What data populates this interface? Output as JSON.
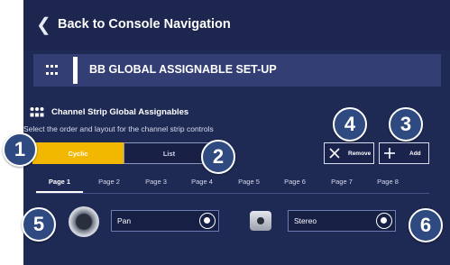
{
  "nav": {
    "back_label": "Back to Console Navigation"
  },
  "header": {
    "title": "BB GLOBAL ASSIGNABLE SET-UP"
  },
  "section": {
    "title": "Channel Strip Global Assignables",
    "description": "Select the order and layout for the channel strip controls"
  },
  "layout_toggle": {
    "options": [
      "Cyclic",
      "List"
    ],
    "selected": "Cyclic"
  },
  "actions": {
    "remove_label": "Remove",
    "add_label": "Add"
  },
  "pages": {
    "tabs": [
      "Page 1",
      "Page 2",
      "Page 3",
      "Page 4",
      "Page 5",
      "Page 6",
      "Page 7",
      "Page 8"
    ],
    "active": "Page 1"
  },
  "assignables": [
    {
      "value": "Pan"
    },
    {
      "value": "Stereo"
    }
  ],
  "callouts": [
    "1",
    "2",
    "3",
    "4",
    "5",
    "6"
  ],
  "colors": {
    "background": "#1f2a54",
    "accent": "#f2b800",
    "callout": "#2f4a80",
    "header_strip": "#333f74"
  }
}
